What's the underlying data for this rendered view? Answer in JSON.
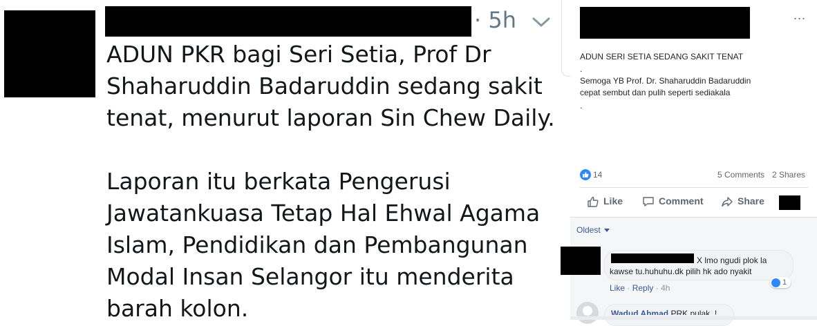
{
  "tweet": {
    "timestamp": "· 5h",
    "paragraph1": "ADUN PKR bagi Seri Setia, Prof Dr Shaharuddin Badaruddin sedang sakit tenat, menurut laporan Sin Chew Daily.",
    "paragraph2": "Laporan itu berkata Pengerusi Jawatankuasa Tetap Hal Ehwal Agama Islam, Pendidikan dan Pembangunan Modal Insan Selangor itu menderita barah kolon."
  },
  "fb_post": {
    "more_icon": "...",
    "lines": [
      "ADUN SERI SETIA SEDANG SAKIT TENAT",
      ".",
      "Semoga YB Prof. Dr. Shaharuddin Badaruddin",
      "cepat sembut dan pulih seperti sediakala",
      "."
    ],
    "like_count": "14",
    "comments_count": "5 Comments",
    "shares_count": "2 Shares",
    "actions": {
      "like": "Like",
      "comment": "Comment",
      "share": "Share"
    },
    "sort_label": "Oldest",
    "comments": [
      {
        "text_line1": "X lmo ngudi plok la",
        "text_line2": "kawse tu.huhuhu.dk pilih hk ado nyakit",
        "like": "Like",
        "reply": "Reply",
        "time": "4h",
        "reaction_count": "1"
      },
      {
        "name": "Wadud Ahmad",
        "text": "PRK pulak..!"
      }
    ],
    "colors": {
      "accent": "#385898",
      "reaction_blue": "#2d88ff"
    }
  }
}
